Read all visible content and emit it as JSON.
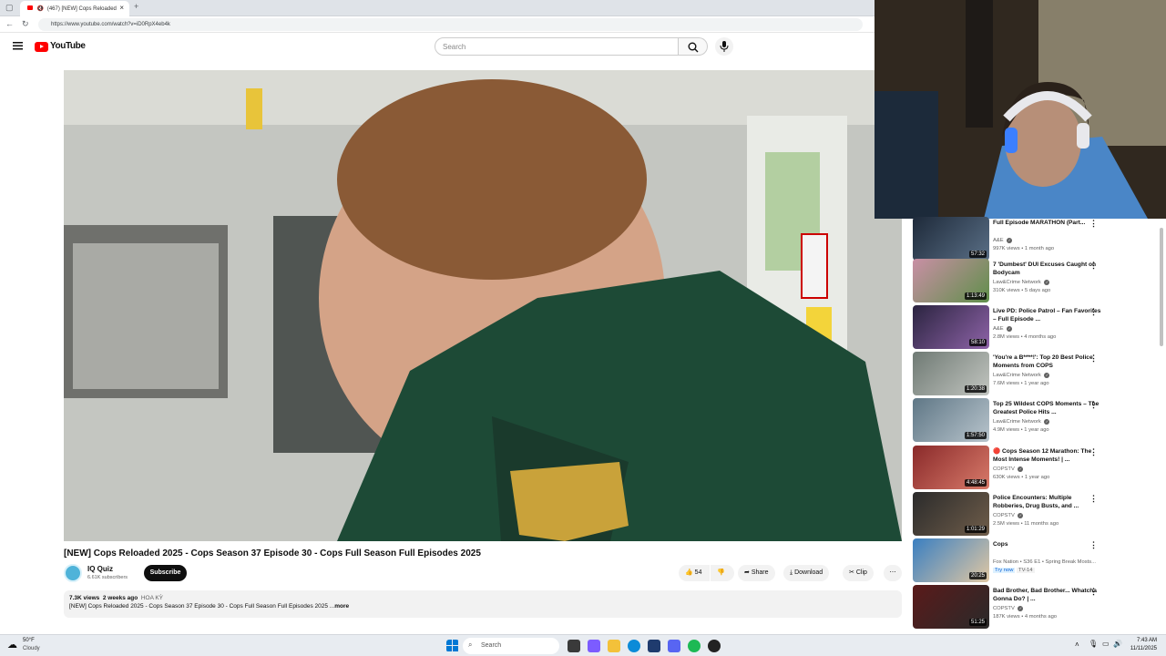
{
  "browser": {
    "tab_title": "(467) [NEW] Cops Reloaded",
    "url": "https://www.youtube.com/watch?v=iD0RpX4eb4k"
  },
  "header": {
    "logo_text": "YouTube",
    "search_placeholder": "Search"
  },
  "video": {
    "title": "[NEW] Cops Reloaded 2025 - Cops Season 37 Episode 30 - Cops Full Season Full Episodes 2025",
    "channel": "IQ Quiz",
    "subscribers": "6.61K subscribers",
    "subscribe_label": "Subscribe",
    "likes": "54",
    "share_label": "Share",
    "download_label": "Download",
    "clip_label": "Clip",
    "views": "7.3K views",
    "age": "2 weeks ago",
    "country": "HOA KỲ",
    "description": "[NEW] Cops Reloaded 2025 - Cops Season 37 Episode 30 - Cops Full Season Full Episodes 2025 ...",
    "more_label": "more"
  },
  "recommendations": [
    {
      "title": "Full Episode MARATHON (Part...",
      "channel": "A&E",
      "verified": true,
      "meta": "997K views • 1 month ago",
      "duration": "57:32",
      "colors": [
        "#1e2a3a",
        "#5a6f86"
      ]
    },
    {
      "title": "7 'Dumbest' DUI Excuses Caught on Bodycam",
      "channel": "Law&Crime Network",
      "verified": true,
      "meta": "310K views • 5 days ago",
      "duration": "1:13:49",
      "colors": [
        "#c98fa5",
        "#5f8f4a"
      ]
    },
    {
      "title": "Live PD: Police Patrol – Fan Favorites – Full Episode ...",
      "channel": "A&E",
      "verified": true,
      "meta": "2.8M views • 4 months ago",
      "duration": "58:10",
      "colors": [
        "#2b2440",
        "#8e63a8"
      ]
    },
    {
      "title": "'You're a B****!': Top 20 Best Police Moments from COPS",
      "channel": "Law&Crime Network",
      "verified": true,
      "meta": "7.6M views • 1 year ago",
      "duration": "1:20:38",
      "colors": [
        "#6f7a74",
        "#c2c5c0"
      ]
    },
    {
      "title": "Top 25 Wildest COPS Moments – The Greatest Police Hits ...",
      "channel": "Law&Crime Network",
      "verified": true,
      "meta": "4.9M views • 1 year ago",
      "duration": "1:57:50",
      "colors": [
        "#5f7786",
        "#b8c4cc"
      ]
    },
    {
      "title": "🔴 Cops Season 12 Marathon: The Most Intense Moments! | ...",
      "channel": "COPSTV",
      "verified": true,
      "meta": "630K views • 1 year ago",
      "duration": "4:48:45",
      "colors": [
        "#8a2a2a",
        "#d87a6a"
      ]
    },
    {
      "title": "Police Encounters: Multiple Robberies, Drug Busts, and ...",
      "channel": "COPSTV",
      "verified": true,
      "meta": "2.5M views • 11 months ago",
      "duration": "1:01:29",
      "colors": [
        "#2b2b2b",
        "#6f5d4a"
      ]
    },
    {
      "title": "Cops",
      "channel": "Fox Nation • S36 E1 • Spring Break Mosts...",
      "verified": false,
      "meta": "",
      "try_now": "Try now",
      "rating": "TV-14",
      "duration": "20:25",
      "colors": [
        "#3a7fc1",
        "#e0c7a3"
      ]
    },
    {
      "title": "Bad Brother, Bad Brother... Whatcha Gonna Do? | ...",
      "channel": "COPSTV",
      "verified": true,
      "meta": "187K views • 4 months ago",
      "duration": "51:25",
      "colors": [
        "#5a1a1a",
        "#2a2a2a"
      ]
    }
  ],
  "taskbar": {
    "weather_temp": "50°F",
    "weather_desc": "Cloudy",
    "search_label": "Search",
    "time": "7:43 AM",
    "date": "11/11/2025"
  }
}
